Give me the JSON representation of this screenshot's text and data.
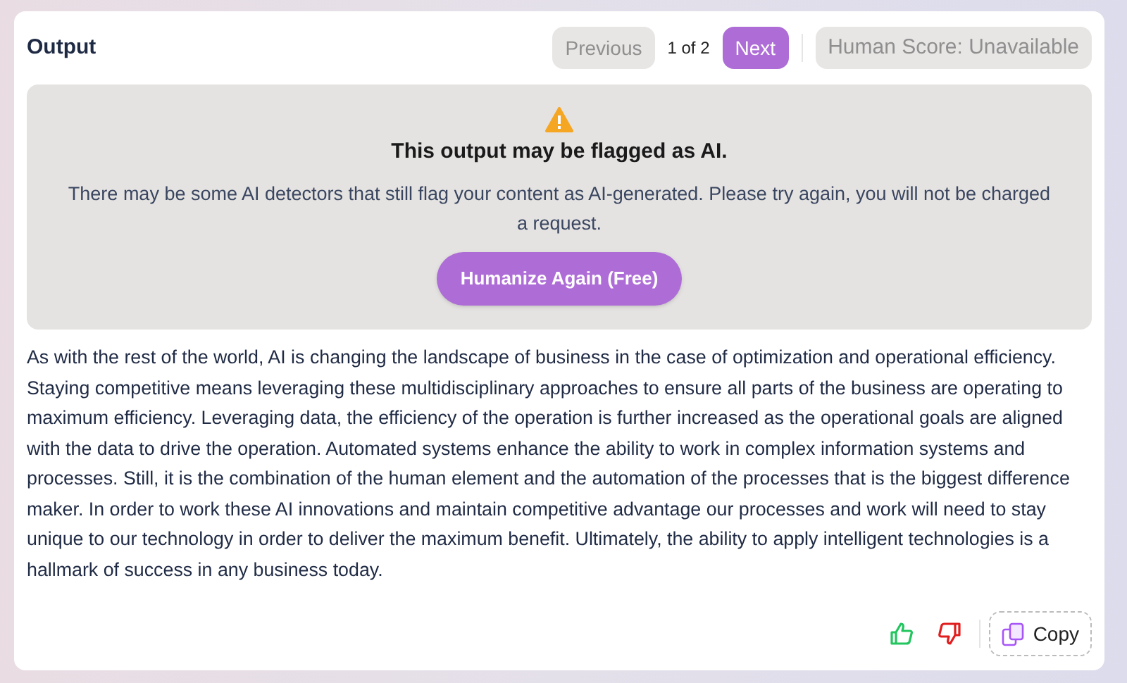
{
  "title": "Output",
  "pager": {
    "previous": {
      "label": "Previous",
      "disabled": true
    },
    "position": "1 of 2",
    "next": {
      "label": "Next",
      "disabled": false
    }
  },
  "human_score": {
    "label": "Human Score: Unavailable",
    "disabled": true
  },
  "alert": {
    "heading": "This output may be flagged as AI.",
    "message": "There may be some AI detectors that still flag your content as AI-generated. Please try again, you will not be charged a request.",
    "button": "Humanize Again (Free)"
  },
  "output_text": "As with the rest of the world, AI is changing the landscape of business in the case of optimization and operational efficiency. Staying competitive means leveraging these multidisciplinary approaches to ensure all parts of the business are operating to maximum efficiency. Leveraging data, the efficiency of the operation is further increased as the operational goals are aligned with the data to drive the operation. Automated systems enhance the ability to work in complex information systems and processes. Still, it is the combination of the human element and the automation of the processes that is the biggest difference maker. In order to work these AI innovations and maintain competitive advantage our processes and work will need to stay unique to our technology in order to deliver the maximum benefit. Ultimately, the ability to apply intelligent technologies is a hallmark of success in any business today.",
  "copy_button": "Copy"
}
